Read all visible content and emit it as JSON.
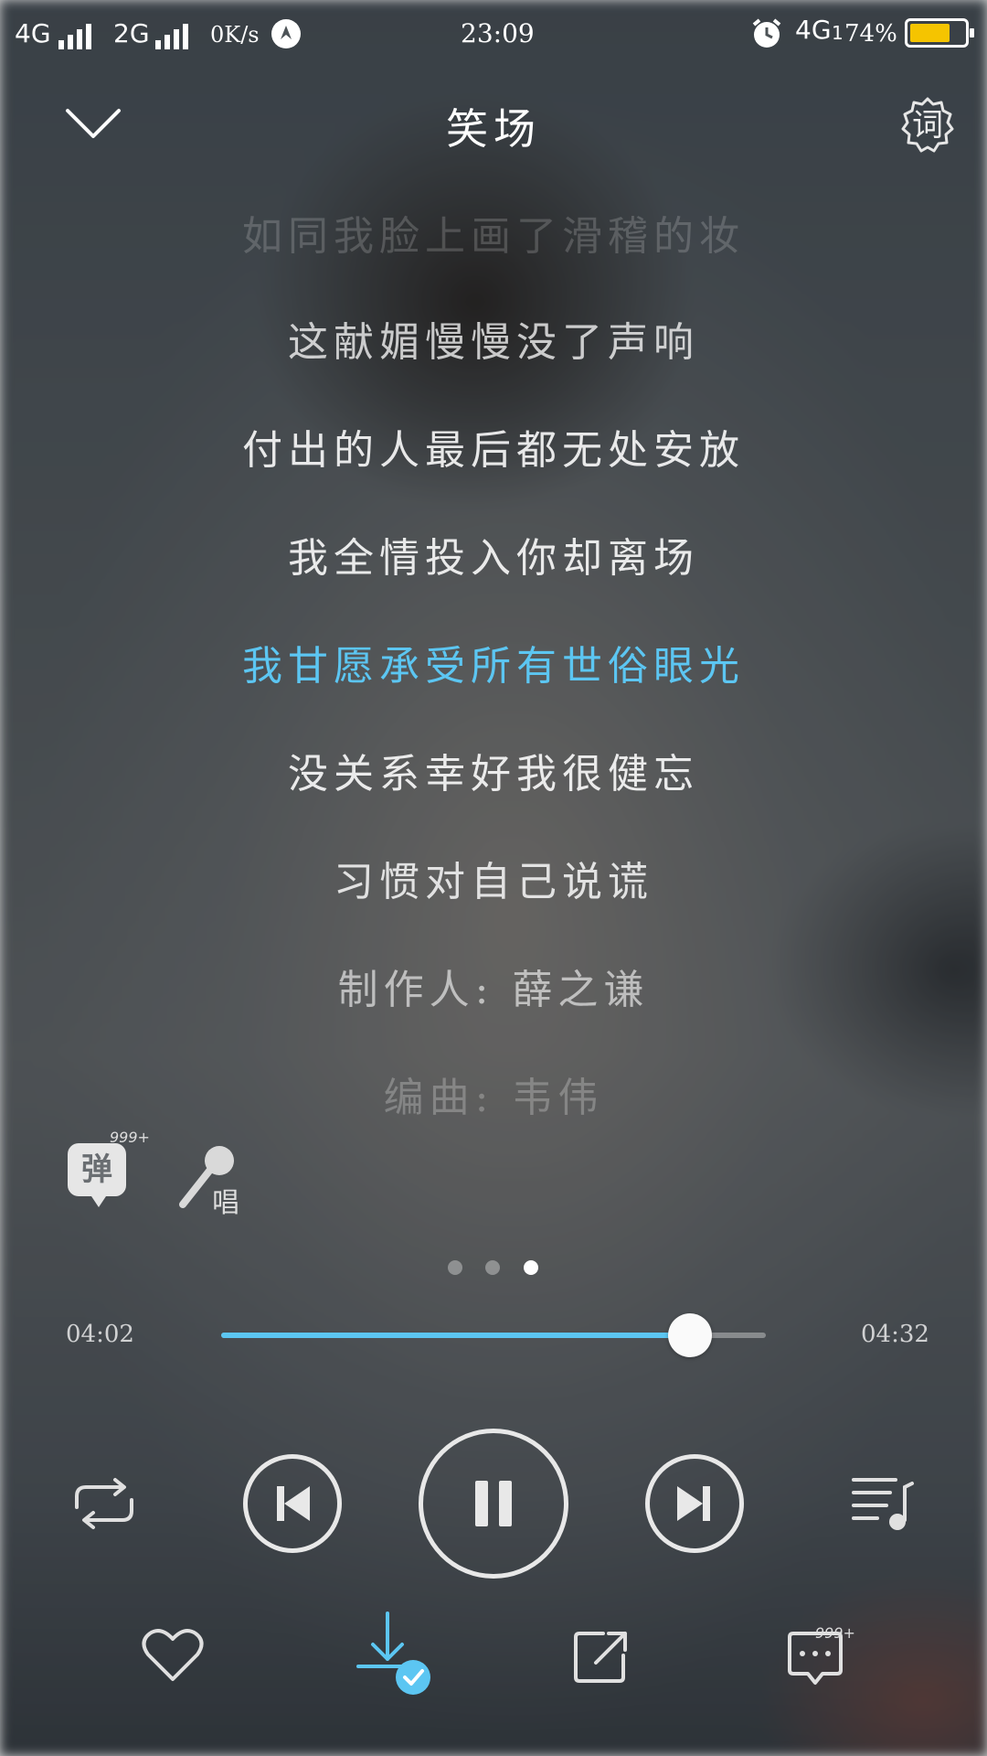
{
  "status_bar": {
    "net1": "4G",
    "net2": "2G",
    "speed": "0K/s",
    "time": "23:09",
    "net3": "4G",
    "net3_sub": "1",
    "battery": "74%",
    "battery_level": 0.74
  },
  "header": {
    "title": "笑场",
    "lyrics_button": "词"
  },
  "lyrics": [
    "如同我脸上画了滑稽的妆",
    "这献媚慢慢没了声响",
    "付出的人最后都无处安放",
    "我全情投入你却离场",
    "我甘愿承受所有世俗眼光",
    "没关系幸好我很健忘",
    "习惯对自己说谎",
    "制作人: 薛之谦",
    "编曲: 韦伟"
  ],
  "current_lyric_index": 4,
  "extras": {
    "danmu_label": "弹",
    "danmu_badge": "999+",
    "sing_label": "唱"
  },
  "pager": {
    "count": 3,
    "active": 2
  },
  "progress": {
    "elapsed": "04:02",
    "total": "04:32",
    "fraction": 0.86
  },
  "colors": {
    "accent": "#5cc6f2",
    "battery": "#f5c400"
  },
  "actions": {
    "comment_badge": "999+"
  }
}
